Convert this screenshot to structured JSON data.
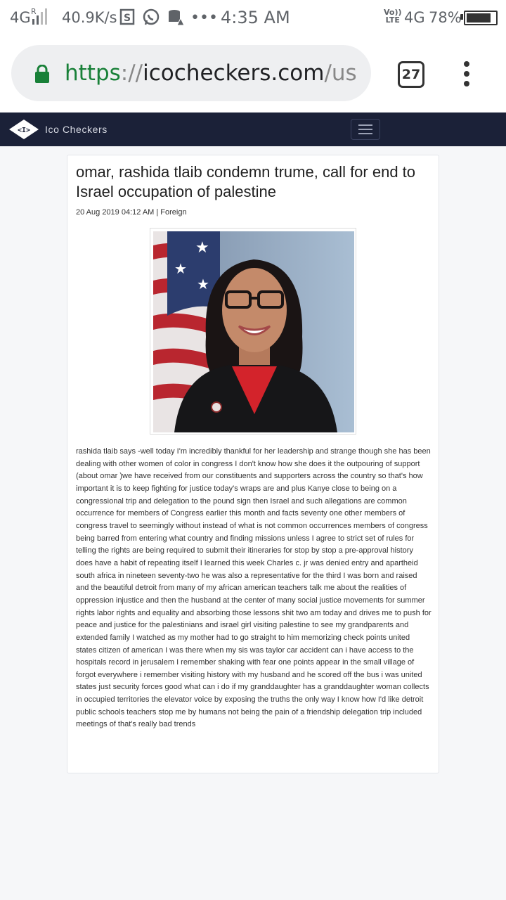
{
  "status_bar": {
    "network": "4G",
    "roaming": "R",
    "speed": "40.9K/s",
    "more": "•••",
    "time": "4:35 AM",
    "volte_top": "Vo))",
    "volte_bottom": "LTE",
    "network2": "4G",
    "battery_pct": "78%",
    "battery_level": 0.78
  },
  "browser": {
    "url_scheme": "https",
    "url_sep": "://",
    "url_host": "icocheckers.com",
    "url_path": "/user",
    "tab_count": "27"
  },
  "navbar": {
    "brand_name": "Ico Checkers",
    "brand_color": "#1b2138"
  },
  "article": {
    "title": "omar, rashida tlaib condemn trume, call for end to Israel occupation of palestine",
    "meta": "20 Aug 2019 04:12 AM | Foreign",
    "body": "rashida tlaib says -well today I'm incredibly thankful for her leadership and strange though she has been dealing with other women of color in congress I don't know how she does it the outpouring of support (about omar )we have received from our constituents and supporters across the country so that's how important it is to keep fighting for justice today's wraps are and plus Kanye close to being on a congressional trip and delegation to the pound sign then Israel and such allegations are common occurrence for members of Congress earlier this month and facts seventy one other members of congress travel to seemingly without instead of what is not common occurrences members of congress being barred from entering what country and finding missions unless I agree to strict set of rules for telling the rights are being required to submit their itineraries for stop by stop a pre-approval history does have a habit of repeating itself I learned this week Charles c. jr was denied entry and apartheid south africa in nineteen seventy-two he was also a representative for the third I was born and raised and the beautiful detroit from many of my african american teachers talk me about the realities of oppression injustice and then the husband at the center of many social justice movements for summer rights labor rights and equality and absorbing those lessons shit two am today and drives me to push for peace and justice for the palestinians and israel girl visiting palestine to see my grandparents and extended family I watched as my mother had to go straight to him memorizing check points united states citizen of american I was there when my sis was taylor car accident can i have access to the hospitals record in jerusalem I remember shaking with fear one points appear in the small village of forgot everywhere i remember visiting history with my husband and he scored off the bus i was united states just security forces good what can i do if my granddaughter has a granddaughter woman collects in occupied territories the elevator voice by exposing the truths the only way I know how I'd like detroit public schools teachers stop me by humans not being the pain of a friendship delegation trip included meetings of that's really bad trends"
  },
  "colors": {
    "secure_green": "#188038",
    "page_bg": "#f6f7f9"
  }
}
